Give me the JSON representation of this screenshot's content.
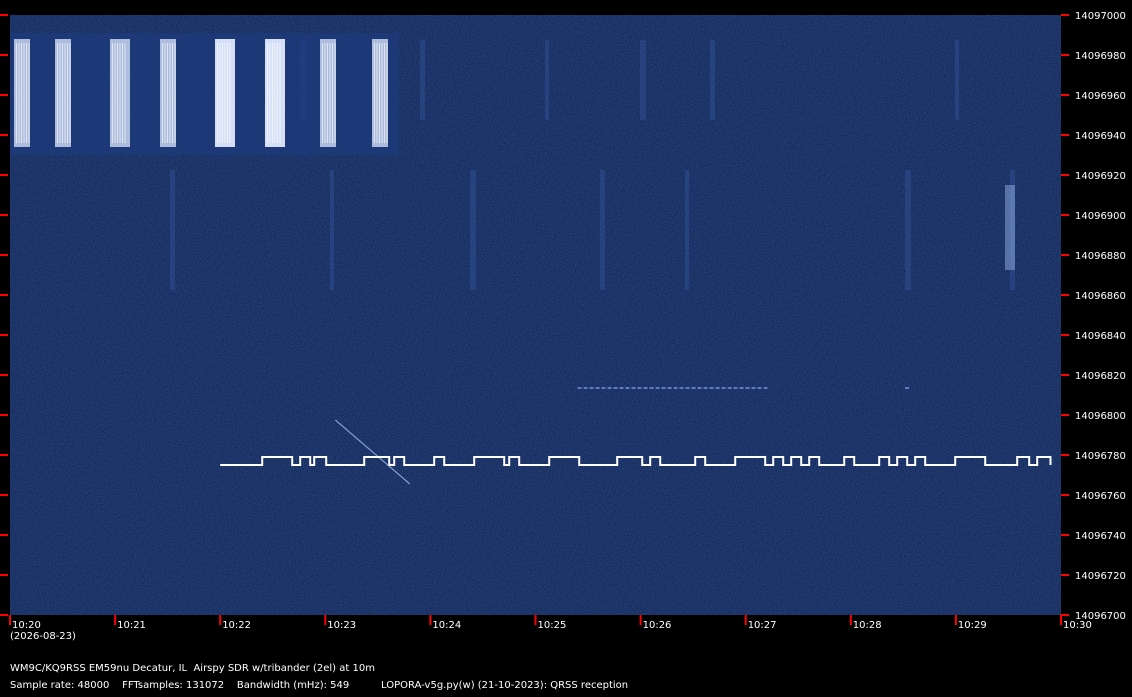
{
  "chart_data": {
    "type": "heatmap",
    "subtype": "spectrogram-waterfall",
    "x_axis": {
      "ticks": [
        "10:20",
        "10:21",
        "10:22",
        "10:23",
        "10:24",
        "10:25",
        "10:26",
        "10:27",
        "10:28",
        "10:29",
        "10:30"
      ],
      "range": [
        "10:20",
        "10:30"
      ]
    },
    "y_axis": {
      "ticks": [
        14097000,
        14096980,
        14096960,
        14096940,
        14096920,
        14096900,
        14096880,
        14096860,
        14096840,
        14096820,
        14096800,
        14096780,
        14096760,
        14096740,
        14096720,
        14096700
      ],
      "range": [
        14096700,
        14097000
      ],
      "unit": "Hz",
      "side": "right"
    },
    "date": "(2026-08-23)",
    "signals": [
      {
        "kind": "burst-band",
        "freq_range": [
          14096934,
          14096988
        ],
        "time_start": "10:20",
        "time_end": "10:23.7"
      },
      {
        "kind": "fsk-trace",
        "freq_low": 14096780,
        "freq_high": 14096786,
        "time_start": "10:22",
        "time_end": "10:29.9"
      },
      {
        "kind": "weak-dots",
        "freq": 14096815,
        "time_start": "10:25.4",
        "time_end": "10:27.2"
      },
      {
        "kind": "diagonal-drift",
        "freq_start": 14096800,
        "freq_end": 14096768,
        "time_start": "10:23",
        "time_end": "10:23.9"
      }
    ],
    "colors": {
      "background": "#0d1f4f",
      "signal": "#ffffff",
      "tick": "#ff0000"
    }
  },
  "footer": {
    "station": "WM9C/KQ9RSS EM59nu Decatur, IL  Airspy SDR w/tribander (2el) at 10m",
    "sample_rate": "Sample rate: 48000",
    "fft_samples": "FFTsamples: 131072",
    "bandwidth": "Bandwidth (mHz): 549",
    "software": "LOPORA-v5g.py(w) (21-10-2023): QRSS reception"
  }
}
